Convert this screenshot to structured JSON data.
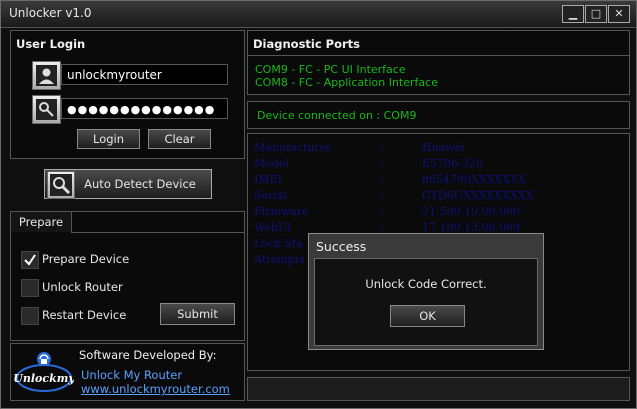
{
  "window": {
    "title": "Unlocker v1.0",
    "controls": {
      "minimize": "▁",
      "maximize": "□",
      "close": "✕"
    }
  },
  "login": {
    "title": "User Login",
    "username": "unlockmyrouter",
    "password": "●●●●●●●●●●●●●●",
    "login_label": "Login",
    "clear_label": "Clear"
  },
  "auto_detect_label": "Auto Detect Device",
  "prepare": {
    "tab_label": "Prepare",
    "items": [
      {
        "label": "Prepare Device",
        "checked": true
      },
      {
        "label": "Unlock Router",
        "checked": false
      },
      {
        "label": "Restart Device",
        "checked": false
      }
    ],
    "submit_label": "Submit"
  },
  "developer": {
    "heading": "Software Developed By:",
    "name": "Unlock My Router",
    "url": "www.unlockmyrouter.com",
    "logo_text": "Unlockmy"
  },
  "diagnostic": {
    "title": "Diagnostic Ports",
    "ports": [
      "COM9 - FC - PC UI Interface",
      "COM8 - FC - Application Interface"
    ]
  },
  "connection_status": "Device connected on : COM9",
  "device_info": [
    {
      "label": "Manufacturer",
      "sep": ":",
      "value": "Huawei"
    },
    {
      "label": "Model",
      "sep": ":",
      "value": "E5786-320"
    },
    {
      "label": "IMEI",
      "sep": ":",
      "value": "8654780XXXXXXX"
    },
    {
      "label": "Serial",
      "sep": ":",
      "value": "GYD6UXXXXXXXXX"
    },
    {
      "label": "Firmware",
      "sep": ":",
      "value": "21.500.19.00.000"
    },
    {
      "label": "WebUI",
      "sep": ":",
      "value": "17.100.13.08.009"
    },
    {
      "label": "Lock Sta",
      "sep": "",
      "value": ""
    },
    {
      "label": "Attempts",
      "sep": "",
      "value": ""
    }
  ],
  "dialog": {
    "title": "Success",
    "message": "Unlock Code Correct.",
    "ok_label": "OK"
  },
  "colors": {
    "green_text": "#18b818",
    "blue_text": "#10107a"
  }
}
